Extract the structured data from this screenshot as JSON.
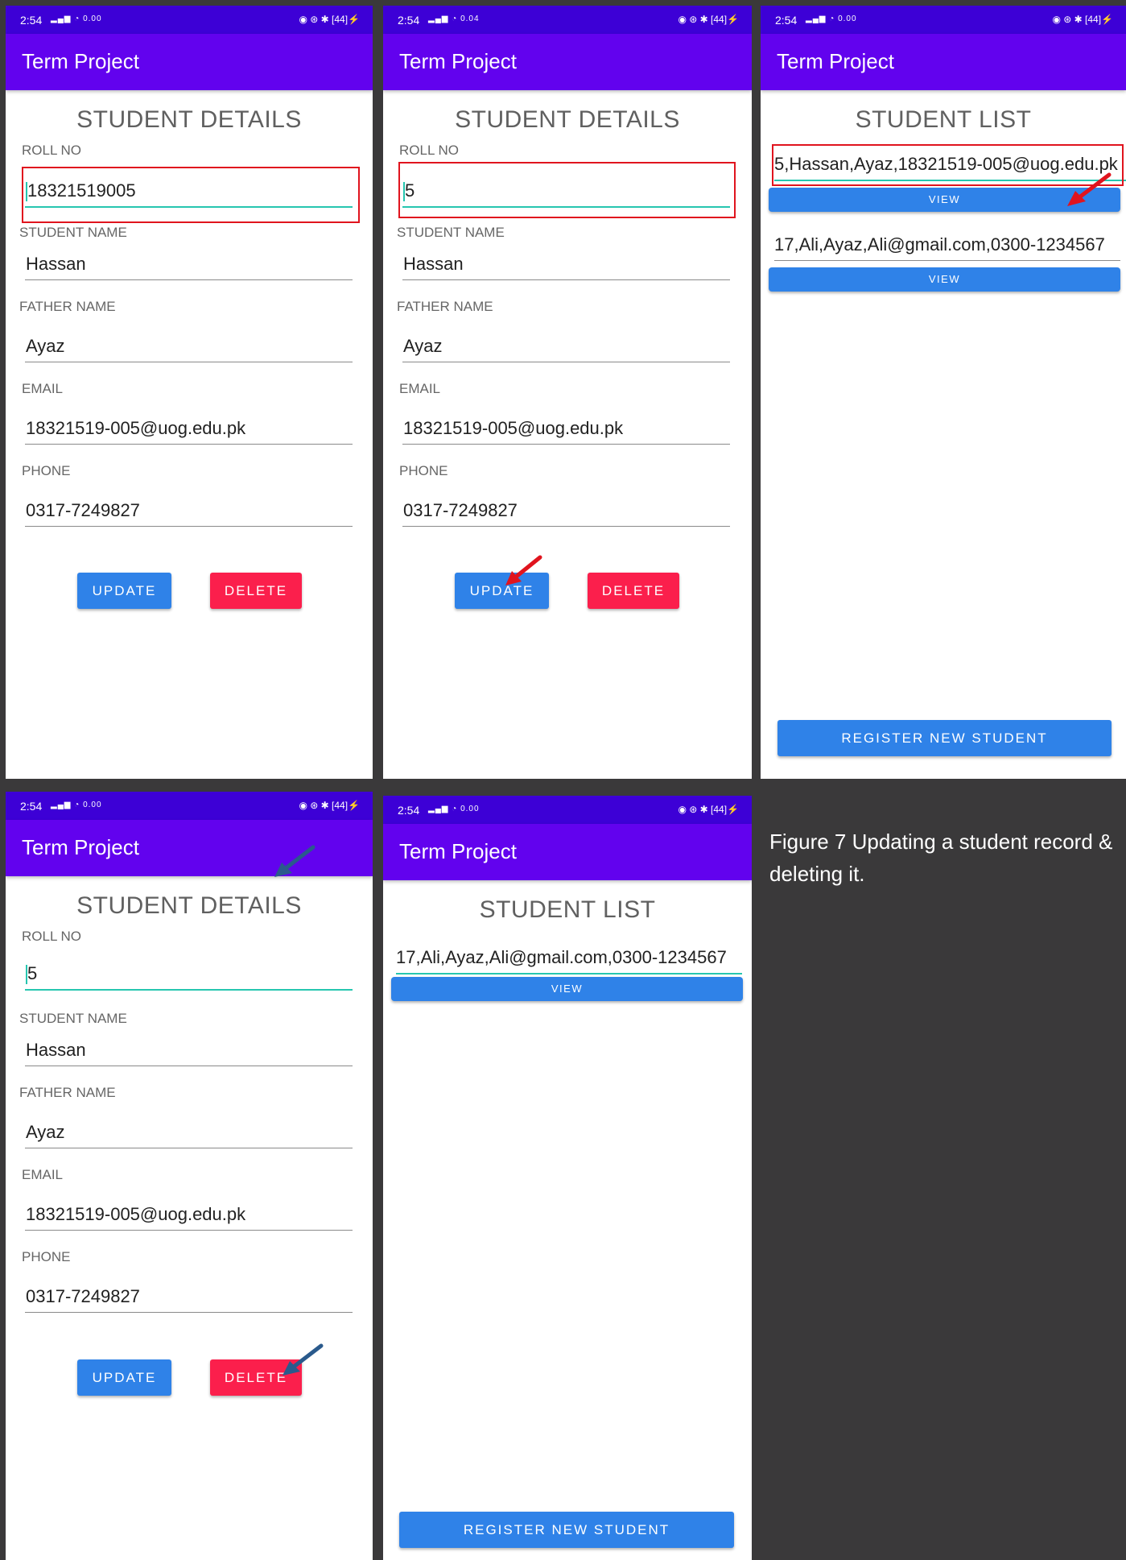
{
  "status_bar": {
    "time": "2:54",
    "net_speed_1": "0.00",
    "net_speed_2": "0.04",
    "net_unit": "KB/S",
    "battery": "44"
  },
  "app": {
    "title": "Term Project"
  },
  "details": {
    "title": "STUDENT DETAILS",
    "labels": {
      "roll": "ROLL NO",
      "name": "STUDENT NAME",
      "father": "FATHER NAME",
      "email": "EMAIL",
      "phone": "PHONE"
    },
    "values_a": {
      "roll": "18321519005",
      "name": "Hassan",
      "father": "Ayaz",
      "email": "18321519-005@uog.edu.pk",
      "phone": "0317-7249827"
    },
    "values_b": {
      "roll": "5",
      "name": "Hassan",
      "father": "Ayaz",
      "email": "18321519-005@uog.edu.pk",
      "phone": "0317-7249827"
    },
    "update_label": "UPDATE",
    "delete_label": "DELETE"
  },
  "list": {
    "title": "STUDENT LIST",
    "items_before": [
      "5,Hassan,Ayaz,18321519-005@uog.edu.pk",
      "17,Ali,Ayaz,Ali@gmail.com,0300-1234567"
    ],
    "items_after": [
      "17,Ali,Ayaz,Ali@gmail.com,0300-1234567"
    ],
    "view_label": "VIEW",
    "register_label": "REGISTER NEW STUDENT"
  },
  "caption": "Figure 7 Updating a student record & deleting it.",
  "colors": {
    "status_bar": "#3d00d6",
    "app_bar": "#6202ee",
    "button_blue": "#2f82e8",
    "button_red": "#fb1f4c",
    "focus_line": "#26c6b0",
    "highlight_box": "#e0141e",
    "arrow_red": "#e0141e",
    "arrow_blue": "#2a5a8c"
  }
}
